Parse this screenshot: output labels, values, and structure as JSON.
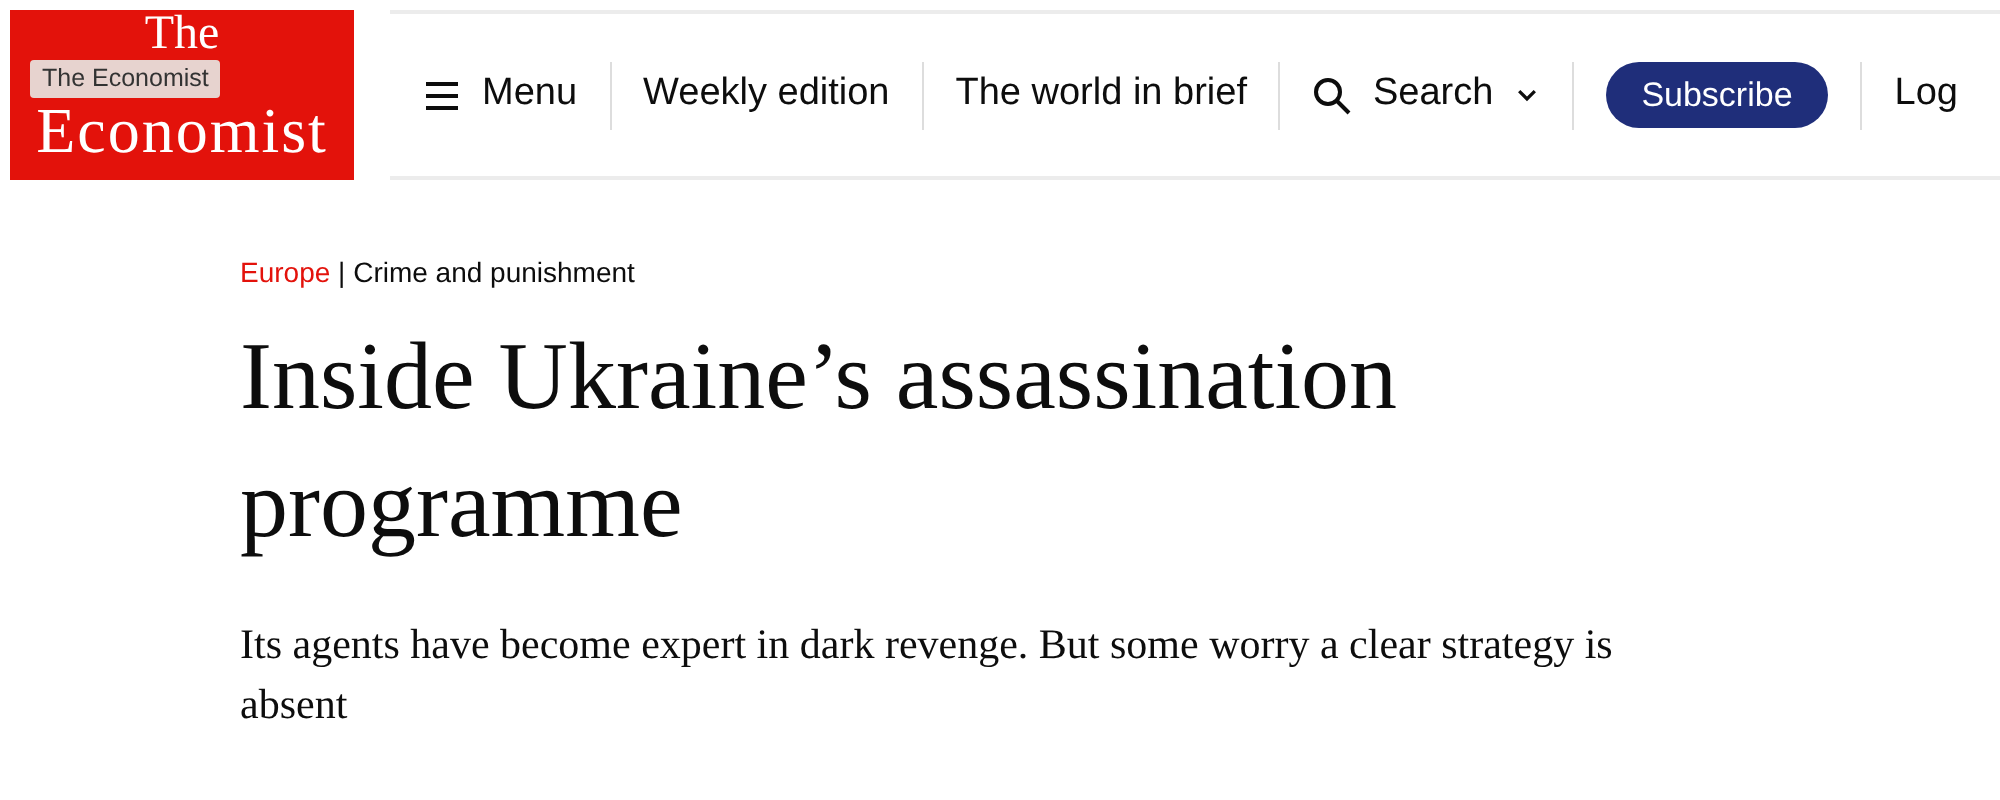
{
  "logo": {
    "lines": [
      "The",
      "Economist"
    ],
    "tooltip": "The Economist"
  },
  "nav": [
    {
      "kind": "menu",
      "label": "Menu"
    },
    {
      "kind": "link",
      "label": "Weekly edition"
    },
    {
      "kind": "link",
      "label": "The world in brief"
    },
    {
      "kind": "search",
      "label": "Search"
    },
    {
      "kind": "button",
      "label": "Subscribe"
    },
    {
      "kind": "link",
      "label": "Log"
    }
  ],
  "article": {
    "section": "Europe",
    "topic": "Crime and punishment",
    "separator": "|",
    "headline": "Inside Ukraine’s assassination programme",
    "standfirst": "Its agents have become expert in dark revenge. But some worry a clear strategy is absent"
  }
}
